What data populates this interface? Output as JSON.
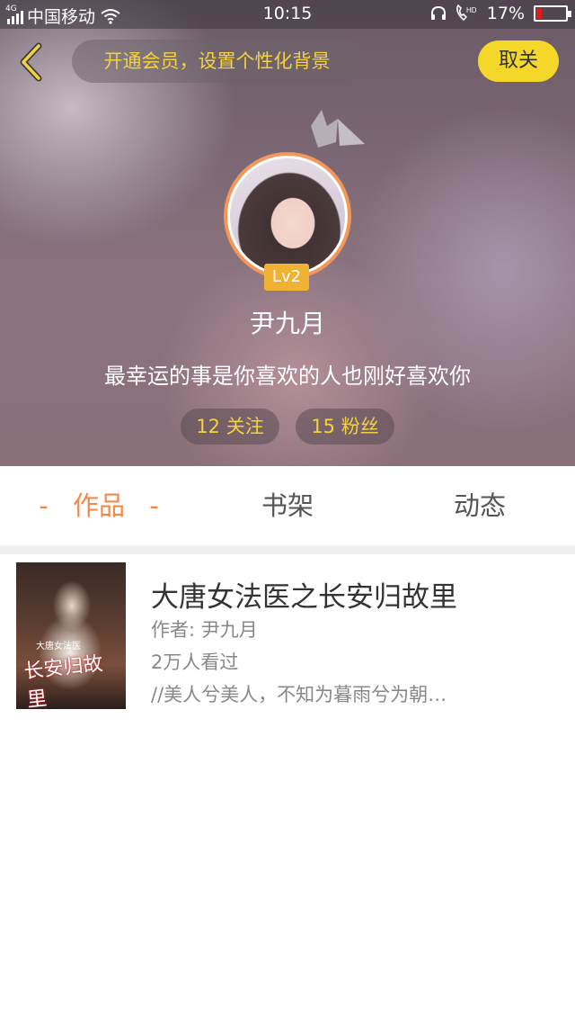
{
  "status_bar": {
    "network_tag": "4G",
    "carrier": "中国移动",
    "time": "10:15",
    "hd_tag": "HD",
    "battery": "17%",
    "battery_color": "#e01a1a"
  },
  "header": {
    "vip_prompt": "开通会员，设置个性化背景",
    "cancel_label": "取关"
  },
  "profile": {
    "level": "Lv2",
    "username": "尹九月",
    "signature": "最幸运的事是你喜欢的人也刚好喜欢你",
    "following": "12 关注",
    "fans": "15 粉丝"
  },
  "tabs": {
    "works": "作品",
    "works_dash": "-",
    "shelf": "书架",
    "feed": "动态",
    "active_color": "#f08a4b"
  },
  "works": [
    {
      "title": "大唐女法医之长安归故里",
      "author": "作者: 尹九月",
      "reads": "2万人看过",
      "excerpt": "//美人兮美人，不知为暮雨兮为朝…",
      "cover_title": "长安归故里",
      "cover_subtitle": "大唐女法医"
    }
  ],
  "colors": {
    "accent_yellow": "#f3d23e",
    "button_yellow": "#f5d72a",
    "avatar_ring": "#f3975a",
    "level_badge": "#f0b232"
  }
}
